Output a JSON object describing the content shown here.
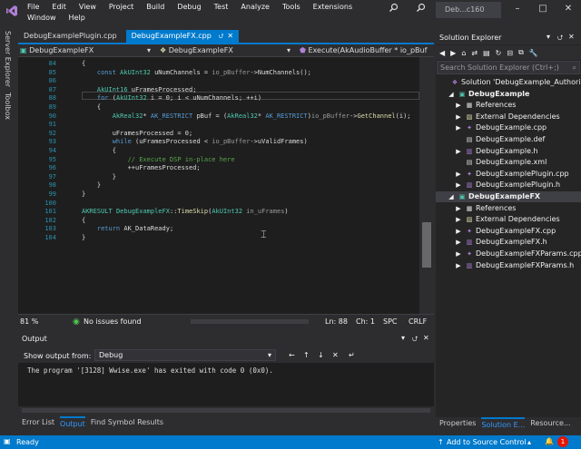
{
  "menu": [
    "File",
    "Edit",
    "View",
    "Project",
    "Build",
    "Debug",
    "Test",
    "Analyze",
    "Tools",
    "Extensions",
    "Window",
    "Help"
  ],
  "window_title": "Deb...c160",
  "left_strip": {
    "server_explorer": "Server Explorer",
    "toolbox": "Toolbox"
  },
  "doc_tabs": [
    {
      "label": "DebugExamplePlugin.cpp"
    },
    {
      "label": "DebugExampleFX.cpp",
      "active": true
    }
  ],
  "nav": {
    "project": "DebugExampleFX",
    "scope": "DebugExampleFX",
    "member": "Execute(AkAudioBuffer * io_pBuf"
  },
  "code": [
    {
      "ln": "84",
      "html": "{"
    },
    {
      "ln": "85",
      "html": "    <span class='kw'>const</span> <span class='ty'>AkUInt32</span> uNumChannels = <span class='pa'>io_pBuffer</span>->NumChannels();"
    },
    {
      "ln": "86",
      "html": ""
    },
    {
      "ln": "87",
      "html": "    <span class='ty'>AkUInt16</span> uFramesProcessed;"
    },
    {
      "ln": "88",
      "html": "    <span class='kw'>for</span> (<span class='ty'>AkUInt32</span> i = 0; i &lt; uNumChannels; ++i)"
    },
    {
      "ln": "89",
      "html": "    {"
    },
    {
      "ln": "90",
      "html": "        <span class='ty'>AkReal32</span>* <span class='kw'>AK_RESTRICT</span> pBuf = (<span class='ty'>AkReal32</span>* <span class='kw'>AK_RESTRICT</span>)<span class='pa'>io_pBuffer</span>-><span class='fn'>GetChannel</span>(i);"
    },
    {
      "ln": "91",
      "html": ""
    },
    {
      "ln": "92",
      "html": "        uFramesProcessed = 0;"
    },
    {
      "ln": "93",
      "html": "        <span class='kw'>while</span> (uFramesProcessed &lt; <span class='pa'>io_pBuffer</span>->uValidFrames)"
    },
    {
      "ln": "94",
      "html": "        {"
    },
    {
      "ln": "95",
      "html": "            <span class='cm'>// Execute DSP in-place here</span>"
    },
    {
      "ln": "96",
      "html": "            ++uFramesProcessed;"
    },
    {
      "ln": "97",
      "html": "        }"
    },
    {
      "ln": "98",
      "html": "    }"
    },
    {
      "ln": "99",
      "html": "}"
    },
    {
      "ln": "100",
      "html": ""
    },
    {
      "ln": "101",
      "html": "<span class='ty'>AKRESULT</span> <span class='ty'>DebugExampleFX</span>::<span class='fn'>TimeSkip</span>(<span class='ty'>AkUInt32</span> <span class='pa'>in_uFrames</span>)"
    },
    {
      "ln": "102",
      "html": "{"
    },
    {
      "ln": "103",
      "html": "    <span class='kw'>return</span> AK_DataReady;"
    },
    {
      "ln": "104",
      "html": "}"
    }
  ],
  "editor_status": {
    "zoom": "81 %",
    "issues": "No issues found",
    "ln": "Ln: 88",
    "ch": "Ch: 1",
    "spc": "SPC",
    "crlf": "CRLF"
  },
  "output": {
    "title": "Output",
    "show_from_label": "Show output from:",
    "source": "Debug",
    "text": "The program '[3128] Wwise.exe' has exited with code 0 (0x0)."
  },
  "bottom_tabs": [
    {
      "label": "Error List"
    },
    {
      "label": "Output",
      "active": true
    },
    {
      "label": "Find Symbol Results"
    }
  ],
  "solution_explorer": {
    "title": "Solution Explorer",
    "search_placeholder": "Search Solution Explorer (Ctrl+;)",
    "items": [
      {
        "label": "Solution 'DebugExample_Authoring'",
        "indent": 0,
        "icon": "solution-icon",
        "expander": ""
      },
      {
        "label": "DebugExample",
        "indent": 1,
        "icon": "project-icon",
        "expander": "◢",
        "bold": true
      },
      {
        "label": "References",
        "indent": 2,
        "icon": "references-icon",
        "expander": "▶"
      },
      {
        "label": "External Dependencies",
        "indent": 2,
        "icon": "dependencies-icon",
        "expander": "▶"
      },
      {
        "label": "DebugExample.cpp",
        "indent": 2,
        "icon": "cpp-file-icon",
        "expander": "▶"
      },
      {
        "label": "DebugExample.def",
        "indent": 2,
        "icon": "def-file-icon",
        "expander": ""
      },
      {
        "label": "DebugExample.h",
        "indent": 2,
        "icon": "header-file-icon",
        "expander": "▶"
      },
      {
        "label": "DebugExample.xml",
        "indent": 2,
        "icon": "xml-file-icon",
        "expander": ""
      },
      {
        "label": "DebugExamplePlugin.cpp",
        "indent": 2,
        "icon": "cpp-file-icon",
        "expander": "▶"
      },
      {
        "label": "DebugExamplePlugin.h",
        "indent": 2,
        "icon": "header-file-icon",
        "expander": "▶"
      },
      {
        "label": "DebugExampleFX",
        "indent": 1,
        "icon": "project-icon",
        "expander": "◢",
        "bold": true,
        "selected": true
      },
      {
        "label": "References",
        "indent": 2,
        "icon": "references-icon",
        "expander": "▶"
      },
      {
        "label": "External Dependencies",
        "indent": 2,
        "icon": "dependencies-icon",
        "expander": "▶"
      },
      {
        "label": "DebugExampleFX.cpp",
        "indent": 2,
        "icon": "cpp-file-icon",
        "expander": "▶"
      },
      {
        "label": "DebugExampleFX.h",
        "indent": 2,
        "icon": "header-file-icon",
        "expander": "▶"
      },
      {
        "label": "DebugExampleFXParams.cpp",
        "indent": 2,
        "icon": "cpp-file-icon",
        "expander": "▶"
      },
      {
        "label": "DebugExampleFXParams.h",
        "indent": 2,
        "icon": "header-file-icon",
        "expander": "▶"
      }
    ],
    "tabs": [
      {
        "label": "Properties"
      },
      {
        "label": "Solution E...",
        "active": true
      },
      {
        "label": "Resource..."
      }
    ]
  },
  "status": {
    "ready": "Ready",
    "source_control": "Add to Source Control",
    "notifications": "1"
  },
  "colors": {
    "accent": "#007acc",
    "editor_bg": "#1e1e1e",
    "chrome_bg": "#2d2d30",
    "keyword": "#569cd6",
    "type": "#4ec9b0",
    "comment": "#57a64a"
  }
}
